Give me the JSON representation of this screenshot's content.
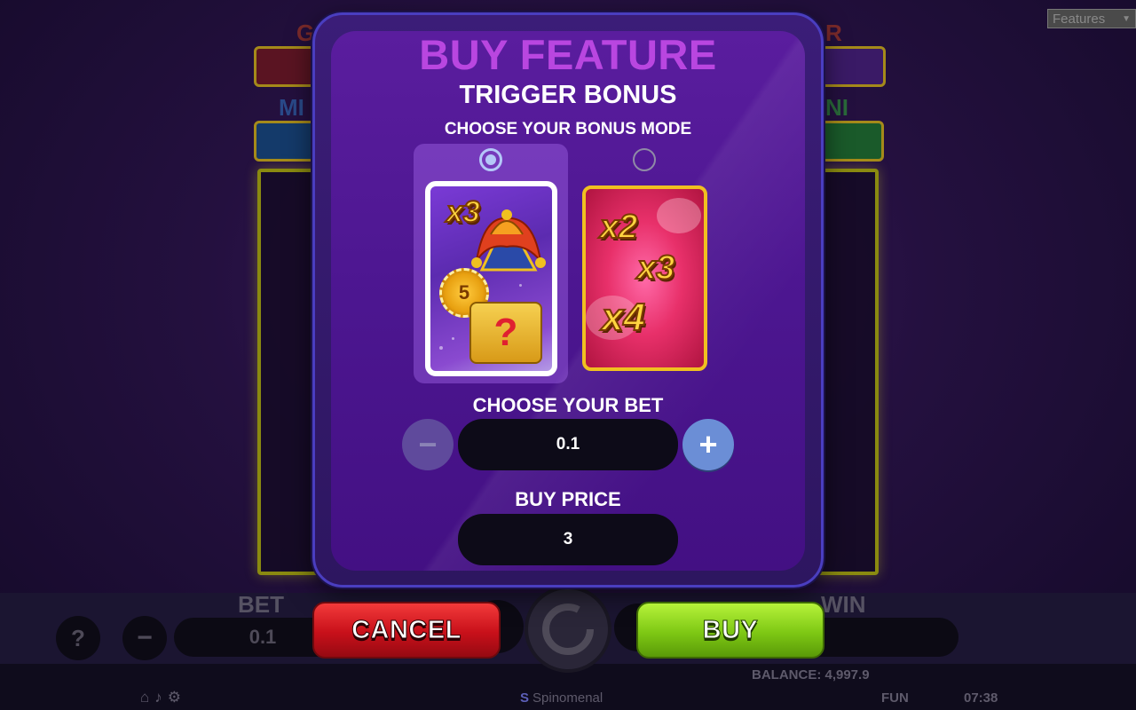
{
  "background": {
    "features_select": "Features",
    "bet_label": "BET",
    "bet_value": "0.1",
    "win_label": "WIN",
    "help_label": "?",
    "balance": "BALANCE: 4,997.9",
    "mode": "FUN",
    "clock": "07:38",
    "brand": "Spinomenal"
  },
  "modal": {
    "title": "BUY FEATURE",
    "subtitle": "TRIGGER BONUS",
    "mode_label": "CHOOSE YOUR BONUS MODE",
    "modes": [
      {
        "selected": true,
        "multipliers": [
          "x3"
        ],
        "chip": "5",
        "chest": "?"
      },
      {
        "selected": false,
        "multipliers": [
          "x2",
          "x3",
          "x4"
        ]
      }
    ],
    "bet_label": "CHOOSE YOUR BET",
    "bet_value": "0.1",
    "minus_symbol": "−",
    "plus_symbol": "+",
    "price_label": "BUY PRICE",
    "price_value": "3"
  },
  "actions": {
    "cancel_label": "CANCEL",
    "buy_label": "BUY"
  },
  "colors": {
    "title": "#b946e0",
    "cancel": "#c8101a",
    "buy": "#7ec814",
    "plus_button": "#6b8ed6"
  }
}
